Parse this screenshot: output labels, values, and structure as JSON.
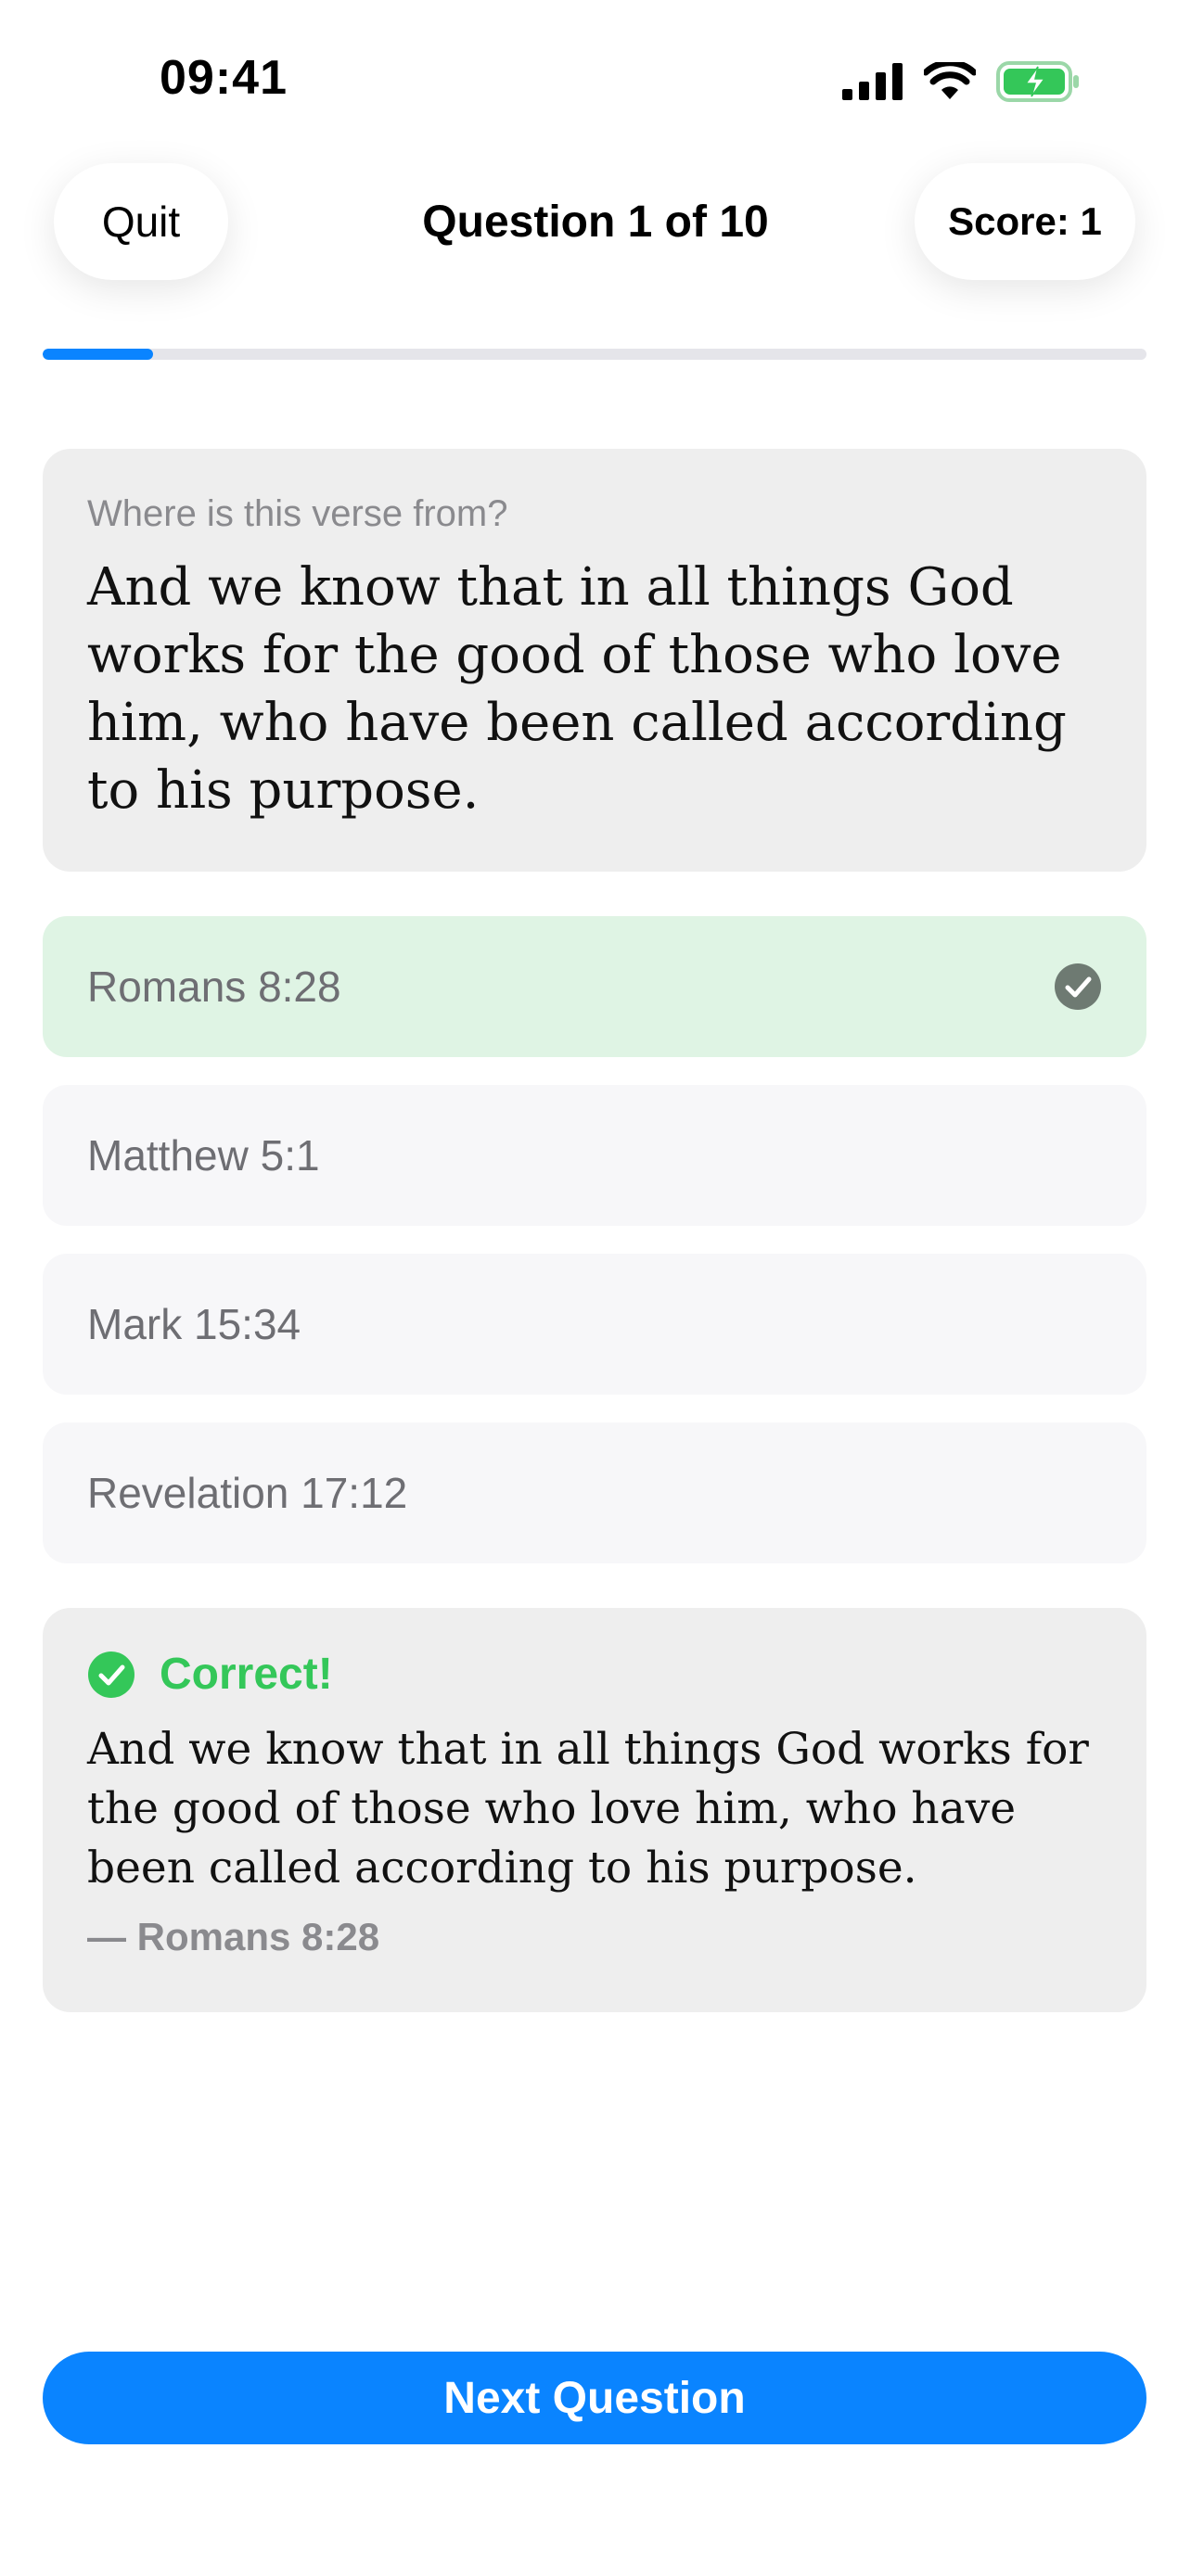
{
  "status_bar": {
    "time": "09:41",
    "icons": [
      "cellular-signal-icon",
      "wifi-icon",
      "battery-charging-icon"
    ]
  },
  "header": {
    "quit_label": "Quit",
    "title": "Question 1 of 10",
    "score_label": "Score: 1"
  },
  "progress": {
    "fraction": 0.1
  },
  "question": {
    "prompt": "Where is this verse from?",
    "verse": "And we know that in all things God works for the good of those who love him, who have been called according to his purpose."
  },
  "answers": [
    {
      "label": "Romans 8:28",
      "state": "correct"
    },
    {
      "label": "Matthew 5:1",
      "state": "default"
    },
    {
      "label": "Mark 15:34",
      "state": "default"
    },
    {
      "label": "Revelation 17:12",
      "state": "default"
    }
  ],
  "feedback": {
    "title": "Correct!",
    "verse": "And we know that in all things God works for the good of those who love him, who have been called according to his purpose.",
    "reference": "— Romans 8:28"
  },
  "next_button": {
    "label": "Next Question"
  },
  "colors": {
    "accent": "#0a84ff",
    "success": "#34c759",
    "correct_answer_bg": "#dff4e4",
    "check_gray": "#6e7a72"
  }
}
